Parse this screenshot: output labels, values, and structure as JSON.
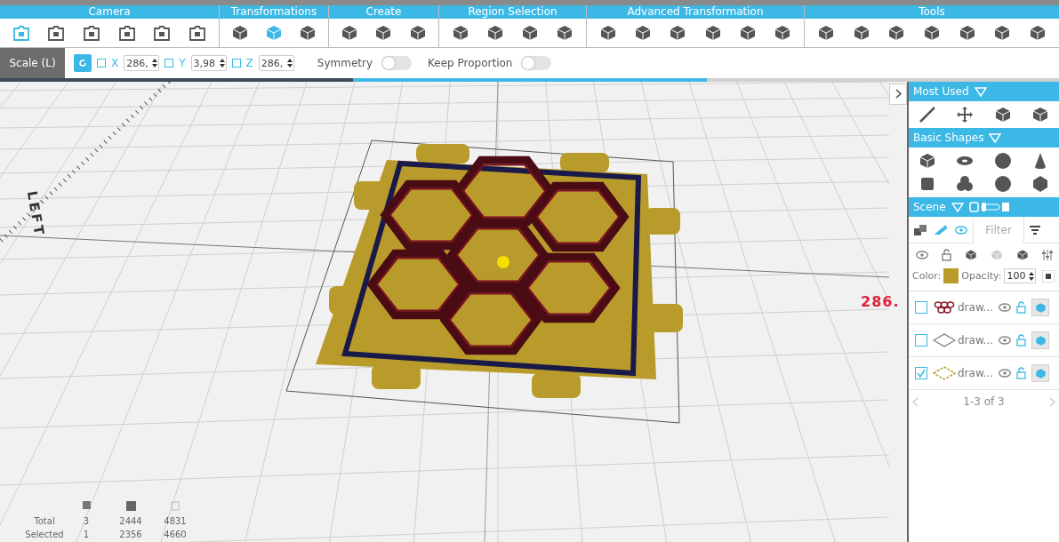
{
  "toolbar": {
    "groups": [
      {
        "label": "Camera",
        "tools": [
          {
            "active": true
          },
          {
            "active": false
          },
          {
            "active": false
          },
          {
            "active": false
          },
          {
            "active": false
          },
          {
            "active": false
          }
        ]
      },
      {
        "label": "Transformations",
        "tools": [
          {
            "active": false
          },
          {
            "active": true
          },
          {
            "active": false
          }
        ]
      },
      {
        "label": "Create",
        "tools": [
          {
            "active": false
          },
          {
            "active": false
          },
          {
            "active": false
          }
        ]
      },
      {
        "label": "Region Selection",
        "tools": [
          {
            "active": false
          },
          {
            "active": false
          },
          {
            "active": false
          },
          {
            "active": false
          }
        ]
      },
      {
        "label": "Advanced Transformation",
        "tools": [
          {
            "active": false
          },
          {
            "active": false
          },
          {
            "active": false
          },
          {
            "active": false
          },
          {
            "active": false
          },
          {
            "active": false
          }
        ]
      },
      {
        "label": "Tools",
        "tools": [
          {
            "active": false
          },
          {
            "active": false
          },
          {
            "active": false
          },
          {
            "active": false
          },
          {
            "active": false
          },
          {
            "active": false
          },
          {
            "active": false
          }
        ]
      }
    ]
  },
  "scale_bar": {
    "mode": "Scale (L)",
    "axes": [
      {
        "label": "X",
        "checked": false,
        "value": "286,"
      },
      {
        "label": "Y",
        "checked": false,
        "value": "3,98"
      },
      {
        "label": "Z",
        "checked": false,
        "value": "286,"
      }
    ],
    "toggles": [
      {
        "label": "Symmetry",
        "on": false
      },
      {
        "label": "Keep Proportion",
        "on": false
      }
    ]
  },
  "viewport": {
    "axis_label": "LEFT",
    "dimension": "286."
  },
  "stats": {
    "rows": [
      {
        "label": "Total",
        "values": [
          "3",
          "2444",
          "4831"
        ]
      },
      {
        "label": "Selected",
        "values": [
          "1",
          "2356",
          "4660"
        ]
      }
    ]
  },
  "panel": {
    "most_used": {
      "title": "Most Used"
    },
    "basic_shapes": {
      "title": "Basic Shapes"
    },
    "scene": {
      "title": "Scene",
      "filter": {
        "placeholder": "Filter"
      },
      "color_label": "Color:",
      "color": "#b89b2a",
      "opacity_label": "Opacity:",
      "opacity": "100",
      "objects": [
        {
          "kind": "honeycomb",
          "name": "draw...",
          "checked": false
        },
        {
          "kind": "outline",
          "name": "draw...",
          "checked": false
        },
        {
          "kind": "frame",
          "name": "draw...",
          "checked": true
        }
      ],
      "pager": "1-3 of 3"
    }
  }
}
